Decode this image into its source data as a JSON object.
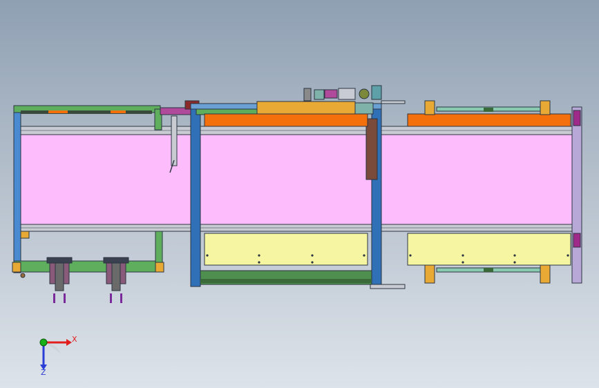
{
  "triad": {
    "x_label": "X",
    "z_label": "Z",
    "colors": {
      "x": "#e11d1d",
      "y": "#18b018",
      "z": "#2a3fd6"
    }
  },
  "palette": {
    "belt": "#fdbcfb",
    "bar": "#f4700c",
    "pad": "#f6f6a2",
    "frame_blue": "#2f70b6",
    "frame_green": "#3f9e3f",
    "tan": "#e9aa35",
    "violet": "#7a2a9a",
    "rail": "#9aa6b2",
    "dark": "#2b3440",
    "brown": "#8a4d2c"
  }
}
